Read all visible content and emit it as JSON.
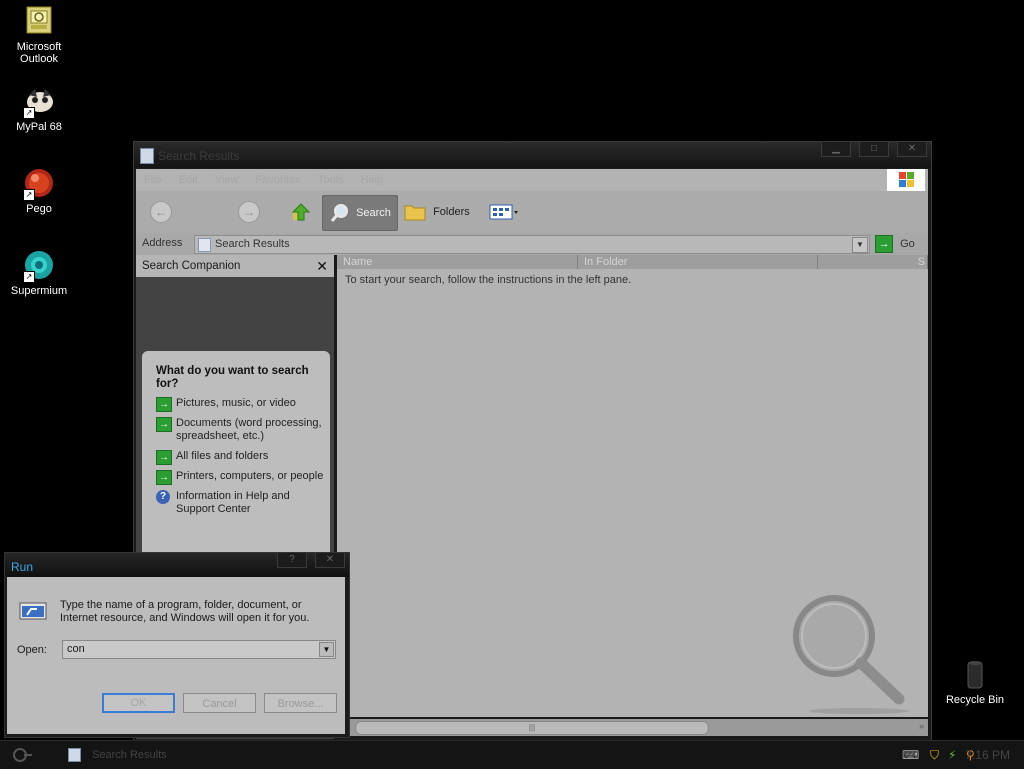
{
  "desktop": {
    "icons": [
      {
        "label": "Microsoft\nOutlook",
        "icon": "outlook-icon"
      },
      {
        "label": "MyPal 68",
        "icon": "mypal-icon"
      },
      {
        "label": "Pego",
        "icon": "pego-icon"
      },
      {
        "label": "Supermium",
        "icon": "supermium-icon"
      },
      {
        "label": "Recycle Bin",
        "icon": "recycle-bin-icon"
      }
    ]
  },
  "explorer": {
    "title": "Search Results",
    "menu": [
      "File",
      "Edit",
      "View",
      "Favorites",
      "Tools",
      "Help"
    ],
    "toolbar": {
      "back": "Back",
      "search": "Search",
      "folders": "Folders"
    },
    "address": {
      "label": "Address",
      "value": "Search Results",
      "go": "Go"
    },
    "companion": {
      "title": "Search Companion",
      "question": "What do you want to search for?",
      "options": [
        "Pictures, music, or video",
        "Documents (word processing, spreadsheet, etc.)",
        "All files and folders",
        "Printers, computers, or people",
        "Information in Help and Support Center"
      ]
    },
    "columns": [
      "Name",
      "In Folder",
      "S"
    ],
    "hint": "To start your search, follow the instructions in the left pane."
  },
  "run_dialog": {
    "title": "Run",
    "description": "Type the name of a program, folder, document, or Internet resource, and Windows will open it for you.",
    "open_label": "Open:",
    "open_value": "con",
    "ok": "OK",
    "cancel": "Cancel",
    "browse": "Browse..."
  },
  "taskbar": {
    "task": "Search Results",
    "clock": "7:16 PM"
  },
  "colors": {
    "accent": "#3fa6e0",
    "go_green": "#2a9d33"
  }
}
